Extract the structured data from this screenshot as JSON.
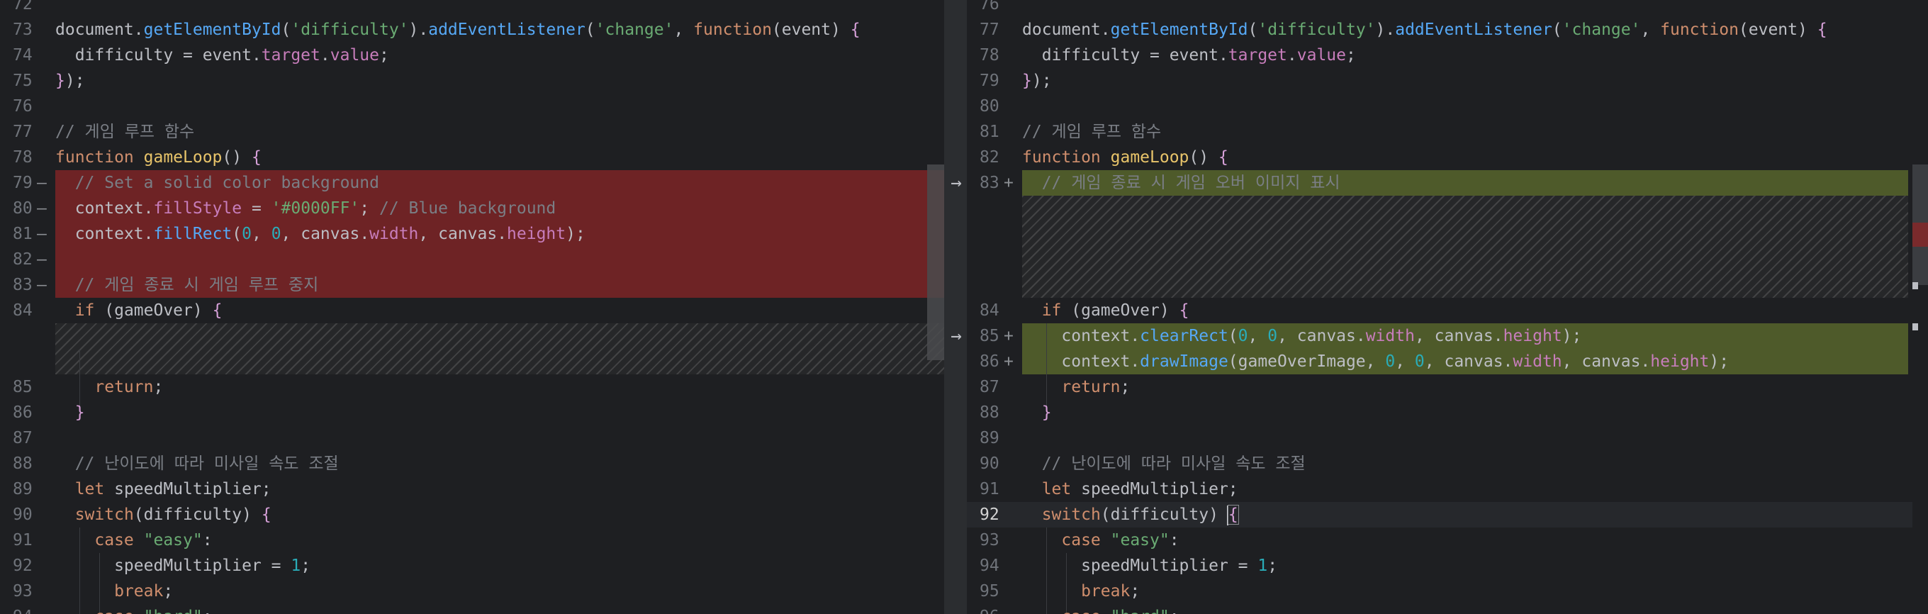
{
  "left": {
    "lines": [
      {
        "num": "72",
        "marker": "",
        "tokens": []
      },
      {
        "num": "73",
        "marker": "",
        "tokens": [
          {
            "t": "document.",
            "c": "def"
          },
          {
            "t": "getElementById",
            "c": "fn"
          },
          {
            "t": "(",
            "c": "def"
          },
          {
            "t": "'difficulty'",
            "c": "str"
          },
          {
            "t": ").",
            "c": "def"
          },
          {
            "t": "addEventListener",
            "c": "fn"
          },
          {
            "t": "(",
            "c": "def"
          },
          {
            "t": "'change'",
            "c": "str"
          },
          {
            "t": ", ",
            "c": "def"
          },
          {
            "t": "function",
            "c": "kw"
          },
          {
            "t": "(event) ",
            "c": "def"
          },
          {
            "t": "{",
            "c": "br"
          }
        ]
      },
      {
        "num": "74",
        "marker": "",
        "tokens": [
          {
            "t": "  difficulty = event.",
            "c": "def"
          },
          {
            "t": "target",
            "c": "prop"
          },
          {
            "t": ".",
            "c": "def"
          },
          {
            "t": "value",
            "c": "prop"
          },
          {
            "t": ";",
            "c": "def"
          }
        ]
      },
      {
        "num": "75",
        "marker": "",
        "tokens": [
          {
            "t": "}",
            "c": "br"
          },
          {
            "t": ");",
            "c": "def"
          }
        ]
      },
      {
        "num": "76",
        "marker": "",
        "tokens": []
      },
      {
        "num": "77",
        "marker": "",
        "tokens": [
          {
            "t": "// 게임 루프 함수",
            "c": "cm"
          }
        ]
      },
      {
        "num": "78",
        "marker": "",
        "tokens": [
          {
            "t": "function ",
            "c": "kw"
          },
          {
            "t": "gameLoop",
            "c": "fnd"
          },
          {
            "t": "() ",
            "c": "def"
          },
          {
            "t": "{",
            "c": "br"
          }
        ]
      },
      {
        "num": "79",
        "marker": "—",
        "tokens": [
          {
            "t": "  // Set a solid color background",
            "c": "cm"
          }
        ]
      },
      {
        "num": "80",
        "marker": "—",
        "tokens": [
          {
            "t": "  context.",
            "c": "def"
          },
          {
            "t": "fillStyle",
            "c": "prop"
          },
          {
            "t": " = ",
            "c": "def"
          },
          {
            "t": "'#0000FF'",
            "c": "str"
          },
          {
            "t": "; ",
            "c": "def"
          },
          {
            "t": "// Blue background",
            "c": "cm"
          }
        ]
      },
      {
        "num": "81",
        "marker": "—",
        "tokens": [
          {
            "t": "  context.",
            "c": "def"
          },
          {
            "t": "fillRect",
            "c": "fn"
          },
          {
            "t": "(",
            "c": "def"
          },
          {
            "t": "0",
            "c": "num"
          },
          {
            "t": ", ",
            "c": "def"
          },
          {
            "t": "0",
            "c": "num"
          },
          {
            "t": ", canvas.",
            "c": "def"
          },
          {
            "t": "width",
            "c": "prop"
          },
          {
            "t": ", canvas.",
            "c": "def"
          },
          {
            "t": "height",
            "c": "prop"
          },
          {
            "t": ");",
            "c": "def"
          }
        ]
      },
      {
        "num": "82",
        "marker": "—",
        "tokens": []
      },
      {
        "num": "83",
        "marker": "—",
        "tokens": [
          {
            "t": "  // 게임 종료 시 게임 루프 중지",
            "c": "cm"
          }
        ]
      },
      {
        "num": "84",
        "marker": "",
        "tokens": [
          {
            "t": "  ",
            "c": "def"
          },
          {
            "t": "if",
            "c": "kw"
          },
          {
            "t": " (gameOver) ",
            "c": "def"
          },
          {
            "t": "{",
            "c": "br"
          }
        ]
      },
      {
        "num": "",
        "marker": "",
        "tokens": []
      },
      {
        "num": "",
        "marker": "",
        "tokens": []
      },
      {
        "num": "85",
        "marker": "",
        "tokens": [
          {
            "t": "    ",
            "c": "def"
          },
          {
            "t": "return",
            "c": "kw"
          },
          {
            "t": ";",
            "c": "def"
          }
        ]
      },
      {
        "num": "86",
        "marker": "",
        "tokens": [
          {
            "t": "  ",
            "c": "def"
          },
          {
            "t": "}",
            "c": "br"
          }
        ]
      },
      {
        "num": "87",
        "marker": "",
        "tokens": []
      },
      {
        "num": "88",
        "marker": "",
        "tokens": [
          {
            "t": "  // 난이도에 따라 미사일 속도 조절",
            "c": "cm"
          }
        ]
      },
      {
        "num": "89",
        "marker": "",
        "tokens": [
          {
            "t": "  ",
            "c": "def"
          },
          {
            "t": "let",
            "c": "kw"
          },
          {
            "t": " speedMultiplier;",
            "c": "def"
          }
        ]
      },
      {
        "num": "90",
        "marker": "",
        "tokens": [
          {
            "t": "  ",
            "c": "def"
          },
          {
            "t": "switch",
            "c": "kw"
          },
          {
            "t": "(difficulty) ",
            "c": "def"
          },
          {
            "t": "{",
            "c": "br"
          }
        ]
      },
      {
        "num": "91",
        "marker": "",
        "tokens": [
          {
            "t": "    ",
            "c": "def"
          },
          {
            "t": "case",
            "c": "kw"
          },
          {
            "t": " ",
            "c": "def"
          },
          {
            "t": "\"easy\"",
            "c": "str"
          },
          {
            "t": ":",
            "c": "def"
          }
        ]
      },
      {
        "num": "92",
        "marker": "",
        "tokens": [
          {
            "t": "      speedMultiplier = ",
            "c": "def"
          },
          {
            "t": "1",
            "c": "num"
          },
          {
            "t": ";",
            "c": "def"
          }
        ]
      },
      {
        "num": "93",
        "marker": "",
        "tokens": [
          {
            "t": "      ",
            "c": "def"
          },
          {
            "t": "break",
            "c": "kw"
          },
          {
            "t": ";",
            "c": "def"
          }
        ]
      },
      {
        "num": "94",
        "marker": "",
        "tokens": [
          {
            "t": "    ",
            "c": "def"
          },
          {
            "t": "case",
            "c": "kw"
          },
          {
            "t": " ",
            "c": "def"
          },
          {
            "t": "\"hard\"",
            "c": "str"
          },
          {
            "t": ":",
            "c": "def"
          }
        ]
      }
    ]
  },
  "right": {
    "lines": [
      {
        "num": "76",
        "marker": "",
        "tokens": []
      },
      {
        "num": "77",
        "marker": "",
        "tokens": [
          {
            "t": "document.",
            "c": "def"
          },
          {
            "t": "getElementById",
            "c": "fn"
          },
          {
            "t": "(",
            "c": "def"
          },
          {
            "t": "'difficulty'",
            "c": "str"
          },
          {
            "t": ").",
            "c": "def"
          },
          {
            "t": "addEventListener",
            "c": "fn"
          },
          {
            "t": "(",
            "c": "def"
          },
          {
            "t": "'change'",
            "c": "str"
          },
          {
            "t": ", ",
            "c": "def"
          },
          {
            "t": "function",
            "c": "kw"
          },
          {
            "t": "(event) ",
            "c": "def"
          },
          {
            "t": "{",
            "c": "br"
          }
        ]
      },
      {
        "num": "78",
        "marker": "",
        "tokens": [
          {
            "t": "  difficulty = event.",
            "c": "def"
          },
          {
            "t": "target",
            "c": "prop"
          },
          {
            "t": ".",
            "c": "def"
          },
          {
            "t": "value",
            "c": "prop"
          },
          {
            "t": ";",
            "c": "def"
          }
        ]
      },
      {
        "num": "79",
        "marker": "",
        "tokens": [
          {
            "t": "}",
            "c": "br"
          },
          {
            "t": ");",
            "c": "def"
          }
        ]
      },
      {
        "num": "80",
        "marker": "",
        "tokens": []
      },
      {
        "num": "81",
        "marker": "",
        "tokens": [
          {
            "t": "// 게임 루프 함수",
            "c": "cm"
          }
        ]
      },
      {
        "num": "82",
        "marker": "",
        "tokens": [
          {
            "t": "function ",
            "c": "kw"
          },
          {
            "t": "gameLoop",
            "c": "fnd"
          },
          {
            "t": "() ",
            "c": "def"
          },
          {
            "t": "{",
            "c": "br"
          }
        ]
      },
      {
        "num": "83",
        "marker": "+",
        "tokens": [
          {
            "t": "  // 게임 종료 시 게임 오버 이미지 표시",
            "c": "cm"
          }
        ]
      },
      {
        "num": "",
        "marker": "",
        "tokens": []
      },
      {
        "num": "",
        "marker": "",
        "tokens": []
      },
      {
        "num": "",
        "marker": "",
        "tokens": []
      },
      {
        "num": "",
        "marker": "",
        "tokens": []
      },
      {
        "num": "84",
        "marker": "",
        "tokens": [
          {
            "t": "  ",
            "c": "def"
          },
          {
            "t": "if",
            "c": "kw"
          },
          {
            "t": " (gameOver) ",
            "c": "def"
          },
          {
            "t": "{",
            "c": "br"
          }
        ]
      },
      {
        "num": "85",
        "marker": "+",
        "tokens": [
          {
            "t": "    context.",
            "c": "def"
          },
          {
            "t": "clearRect",
            "c": "fn"
          },
          {
            "t": "(",
            "c": "def"
          },
          {
            "t": "0",
            "c": "num"
          },
          {
            "t": ", ",
            "c": "def"
          },
          {
            "t": "0",
            "c": "num"
          },
          {
            "t": ", canvas.",
            "c": "def"
          },
          {
            "t": "width",
            "c": "prop"
          },
          {
            "t": ", canvas.",
            "c": "def"
          },
          {
            "t": "height",
            "c": "prop"
          },
          {
            "t": ");",
            "c": "def"
          }
        ]
      },
      {
        "num": "86",
        "marker": "+",
        "tokens": [
          {
            "t": "    context.",
            "c": "def"
          },
          {
            "t": "drawImage",
            "c": "fn"
          },
          {
            "t": "(gameOverImage, ",
            "c": "def"
          },
          {
            "t": "0",
            "c": "num"
          },
          {
            "t": ", ",
            "c": "def"
          },
          {
            "t": "0",
            "c": "num"
          },
          {
            "t": ", canvas.",
            "c": "def"
          },
          {
            "t": "width",
            "c": "prop"
          },
          {
            "t": ", canvas.",
            "c": "def"
          },
          {
            "t": "height",
            "c": "prop"
          },
          {
            "t": ");",
            "c": "def"
          }
        ]
      },
      {
        "num": "87",
        "marker": "",
        "tokens": [
          {
            "t": "    ",
            "c": "def"
          },
          {
            "t": "return",
            "c": "kw"
          },
          {
            "t": ";",
            "c": "def"
          }
        ]
      },
      {
        "num": "88",
        "marker": "",
        "tokens": [
          {
            "t": "  ",
            "c": "def"
          },
          {
            "t": "}",
            "c": "br"
          }
        ]
      },
      {
        "num": "89",
        "marker": "",
        "tokens": []
      },
      {
        "num": "90",
        "marker": "",
        "tokens": [
          {
            "t": "  // 난이도에 따라 미사일 속도 조절",
            "c": "cm"
          }
        ]
      },
      {
        "num": "91",
        "marker": "",
        "tokens": [
          {
            "t": "  ",
            "c": "def"
          },
          {
            "t": "let",
            "c": "kw"
          },
          {
            "t": " speedMultiplier;",
            "c": "def"
          }
        ]
      },
      {
        "num": "92",
        "marker": "",
        "current": true,
        "tokens": [
          {
            "t": "  ",
            "c": "def"
          },
          {
            "t": "switch",
            "c": "kw"
          },
          {
            "t": "(difficulty) ",
            "c": "def"
          },
          {
            "t": "{",
            "c": "br"
          }
        ]
      },
      {
        "num": "93",
        "marker": "",
        "tokens": [
          {
            "t": "    ",
            "c": "def"
          },
          {
            "t": "case",
            "c": "kw"
          },
          {
            "t": " ",
            "c": "def"
          },
          {
            "t": "\"easy\"",
            "c": "str"
          },
          {
            "t": ":",
            "c": "def"
          }
        ]
      },
      {
        "num": "94",
        "marker": "",
        "tokens": [
          {
            "t": "      speedMultiplier = ",
            "c": "def"
          },
          {
            "t": "1",
            "c": "num"
          },
          {
            "t": ";",
            "c": "def"
          }
        ]
      },
      {
        "num": "95",
        "marker": "",
        "tokens": [
          {
            "t": "      ",
            "c": "def"
          },
          {
            "t": "break",
            "c": "kw"
          },
          {
            "t": ";",
            "c": "def"
          }
        ]
      },
      {
        "num": "96",
        "marker": "",
        "tokens": [
          {
            "t": "    ",
            "c": "def"
          },
          {
            "t": "case",
            "c": "kw"
          },
          {
            "t": " ",
            "c": "def"
          },
          {
            "t": "\"hard\"",
            "c": "str"
          },
          {
            "t": ":",
            "c": "def"
          }
        ]
      }
    ]
  },
  "icons": {
    "apply_change": "arrow-right-icon"
  },
  "colors": {
    "background": "#1e1f22",
    "deleted_block": "#6e2325",
    "inserted_block": "#4e5a2a",
    "keyword": "#cf8e6d",
    "function_call": "#56a8f5",
    "string": "#6aab73",
    "number": "#2aacb8",
    "comment": "#7a7e85",
    "property": "#c77dbb"
  }
}
